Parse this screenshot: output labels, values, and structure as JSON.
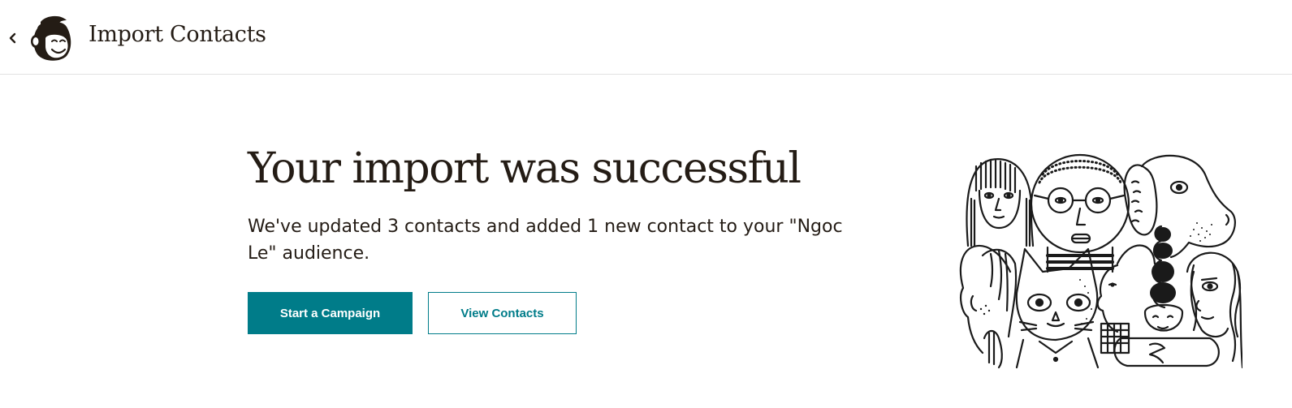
{
  "header": {
    "title": "Import Contacts",
    "back_icon": "chevron-left-icon",
    "logo_icon": "mailchimp-freddie-logo"
  },
  "main": {
    "headline": "Your import was successful",
    "message": "We've updated 3 contacts and added 1 new contact to your \"Ngoc Le\" audience.",
    "primary_button": "Start a Campaign",
    "secondary_button": "View Contacts"
  },
  "illustration": {
    "description_icon": "people-group-illustration"
  },
  "colors": {
    "accent": "#007c89",
    "text": "#241c15",
    "border": "#e2e2e2"
  }
}
